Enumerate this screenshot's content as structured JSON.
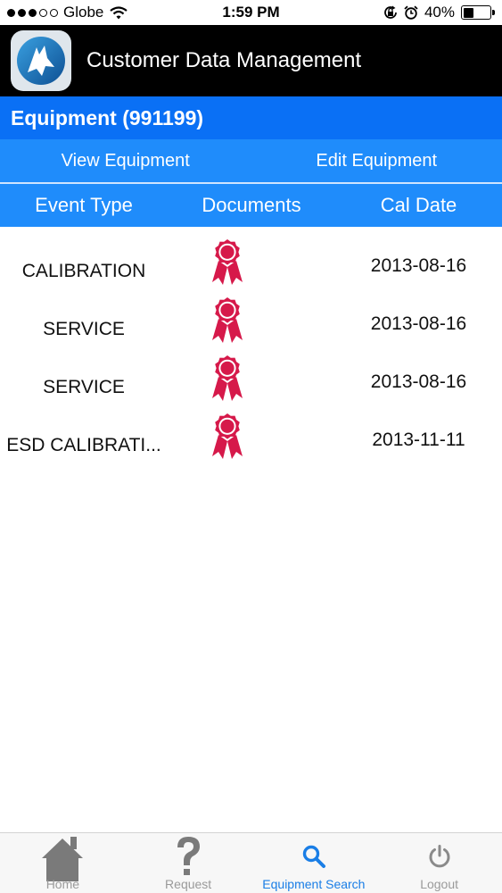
{
  "status_bar": {
    "carrier": "Globe",
    "time": "1:59 PM",
    "battery": "40%",
    "battery_level": 0.4
  },
  "header": {
    "title": "Customer Data Management"
  },
  "equipment": {
    "title": "Equipment (991199)"
  },
  "actions": {
    "view": "View Equipment",
    "edit": "Edit Equipment"
  },
  "columns": {
    "event_type": "Event Type",
    "documents": "Documents",
    "cal_date": "Cal Date"
  },
  "rows": [
    {
      "event_type": "CALIBRATION",
      "doc_icon": "award-ribbon-icon",
      "cal_date": "2013-08-16"
    },
    {
      "event_type": "SERVICE",
      "doc_icon": "award-ribbon-icon",
      "cal_date": "2013-08-16"
    },
    {
      "event_type": "SERVICE",
      "doc_icon": "award-ribbon-icon",
      "cal_date": "2013-08-16"
    },
    {
      "event_type": "ESD CALIBRATI...",
      "doc_icon": "award-ribbon-icon",
      "cal_date": "2013-11-11"
    }
  ],
  "tabs": [
    {
      "label": "Home",
      "icon": "home-icon"
    },
    {
      "label": "Request",
      "icon": "question-mark-icon"
    },
    {
      "label": "Equipment Search",
      "icon": "search-icon",
      "active": true
    },
    {
      "label": "Logout",
      "icon": "power-icon"
    }
  ],
  "colors": {
    "header_bg": "#000000",
    "banner_bg": "#0a70f5",
    "bar_bg": "#1f8cfb",
    "ribbon": "#d6194a",
    "tab_active": "#1a7ee6",
    "tab_inactive": "#9a9a9a"
  }
}
